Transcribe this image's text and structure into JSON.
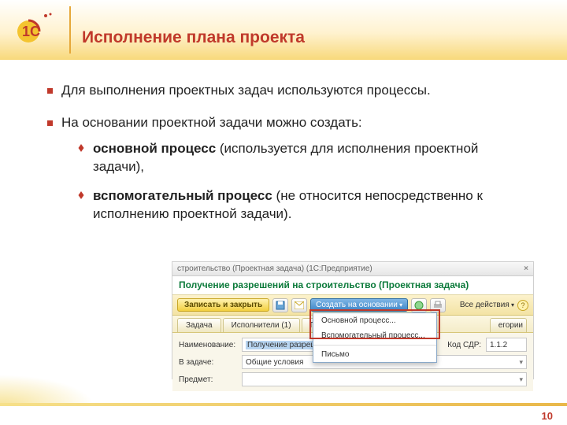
{
  "header": {
    "title": "Исполнение плана проекта"
  },
  "bullets": {
    "b1": "Для выполнения проектных задач используются процессы.",
    "b2": "На основании проектной задачи можно создать:",
    "s1_bold": "основной процесс",
    "s1_rest": " (используется для исполнения проектной задачи),",
    "s2_bold": "вспомогательный процесс",
    "s2_rest": " (не относится непосредственно к исполнению проектной задачи)."
  },
  "shot": {
    "titlebar": "строительство (Проектная задача) (1С:Предприятие)",
    "header": "Получение разрешений на строительство (Проектная задача)",
    "toolbar": {
      "save_close": "Записать и закрыть",
      "create_based": "Создать на основании",
      "all_actions": "Все действия"
    },
    "dropdown": {
      "main_proc": "Основной процесс...",
      "aux_proc": "Вспомогательный процесс...",
      "letter": "Письмо"
    },
    "tabs": {
      "task": "Задача",
      "executors": "Исполнители (1)",
      "pr_cut": "Пр",
      "cat_cut": "егории"
    },
    "form": {
      "name_label": "Наименование:",
      "name_value": "Получение разрешений",
      "in_task_label": "В задаче:",
      "in_task_value": "Общие условия",
      "subject_label": "Предмет:",
      "code_label": "Код СДР:",
      "code_value": "1.1.2"
    }
  },
  "page": {
    "num": "10"
  }
}
